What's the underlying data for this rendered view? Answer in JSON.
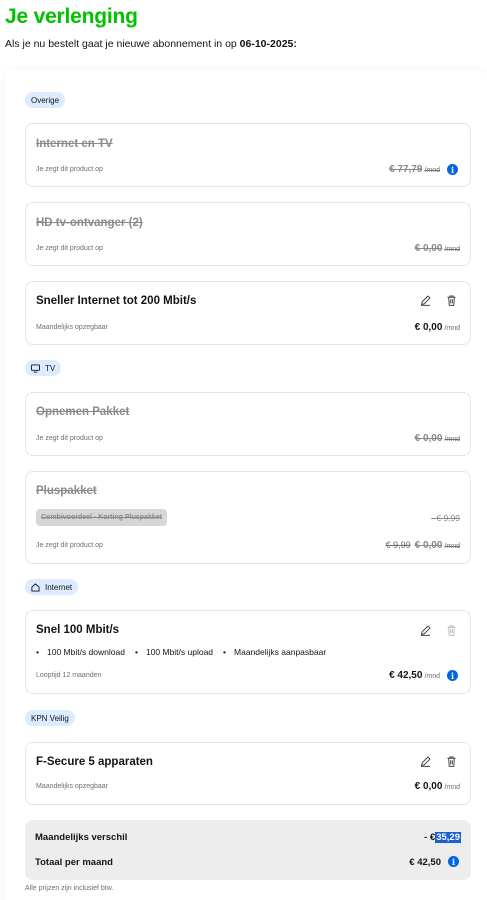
{
  "header": {
    "title": "Je verlenging",
    "intro_prefix": "Als je nu bestelt gaat je nieuwe abonnement in op ",
    "intro_date": "06-10-2025:"
  },
  "sections": {
    "overige": {
      "badge": "Overige"
    },
    "tv": {
      "badge": "TV",
      "icon": "tv-icon"
    },
    "internet": {
      "badge": "Internet",
      "icon": "home-icon"
    },
    "kpn_veilig": {
      "badge": "KPN Veilig"
    }
  },
  "cards": {
    "internet_tv": {
      "title": "Internet en TV",
      "sub": "Je zegt dit product op",
      "price": "€ 77,79",
      "unit": "/mnd"
    },
    "hd_ontvanger": {
      "title": "HD tv-ontvanger (2)",
      "sub": "Je zegt dit product op",
      "price": "€ 0,00",
      "unit": "/mnd"
    },
    "sneller_internet": {
      "title": "Sneller Internet tot 200 Mbit/s",
      "sub": "Maandelijks opzegbaar",
      "price": "€ 0,00",
      "unit": "/mnd"
    },
    "opnemen": {
      "title": "Opnemen Pakket",
      "sub": "Je zegt dit product op",
      "price": "€ 0,00",
      "unit": "/mnd"
    },
    "pluspakket": {
      "title": "Pluspakket",
      "discount_label": "Combivoordeel - Korting Pluspakket",
      "discount_price": "- € 9,99",
      "sub": "Je zegt dit product op",
      "old_price": "€ 9,99",
      "price": "€ 0,00",
      "unit": "/mnd"
    },
    "snel100": {
      "title": "Snel 100 Mbit/s",
      "features": [
        "100 Mbit/s download",
        "100 Mbit/s upload",
        "Maandelijks aanpasbaar"
      ],
      "sub": "Looptijd 12 maanden",
      "price": "€ 42,50",
      "unit": "/mnd"
    },
    "fsecure": {
      "title": "F-Secure 5 apparaten",
      "sub": "Maandelijks opzegbaar",
      "price": "€ 0,00",
      "unit": "/mnd"
    }
  },
  "summary": {
    "diff_label": "Maandelijks verschil",
    "diff_prefix": "- €",
    "diff_value": "35,29",
    "total_label": "Totaal per maand",
    "total_value": "€ 42,50"
  },
  "footnote": "Alle prijzen zijn inclusief btw.",
  "colors": {
    "brand_green": "#00c300",
    "info_blue": "#0066e6",
    "badge_bg": "#dcebff",
    "highlight": "#1a5ed8"
  }
}
